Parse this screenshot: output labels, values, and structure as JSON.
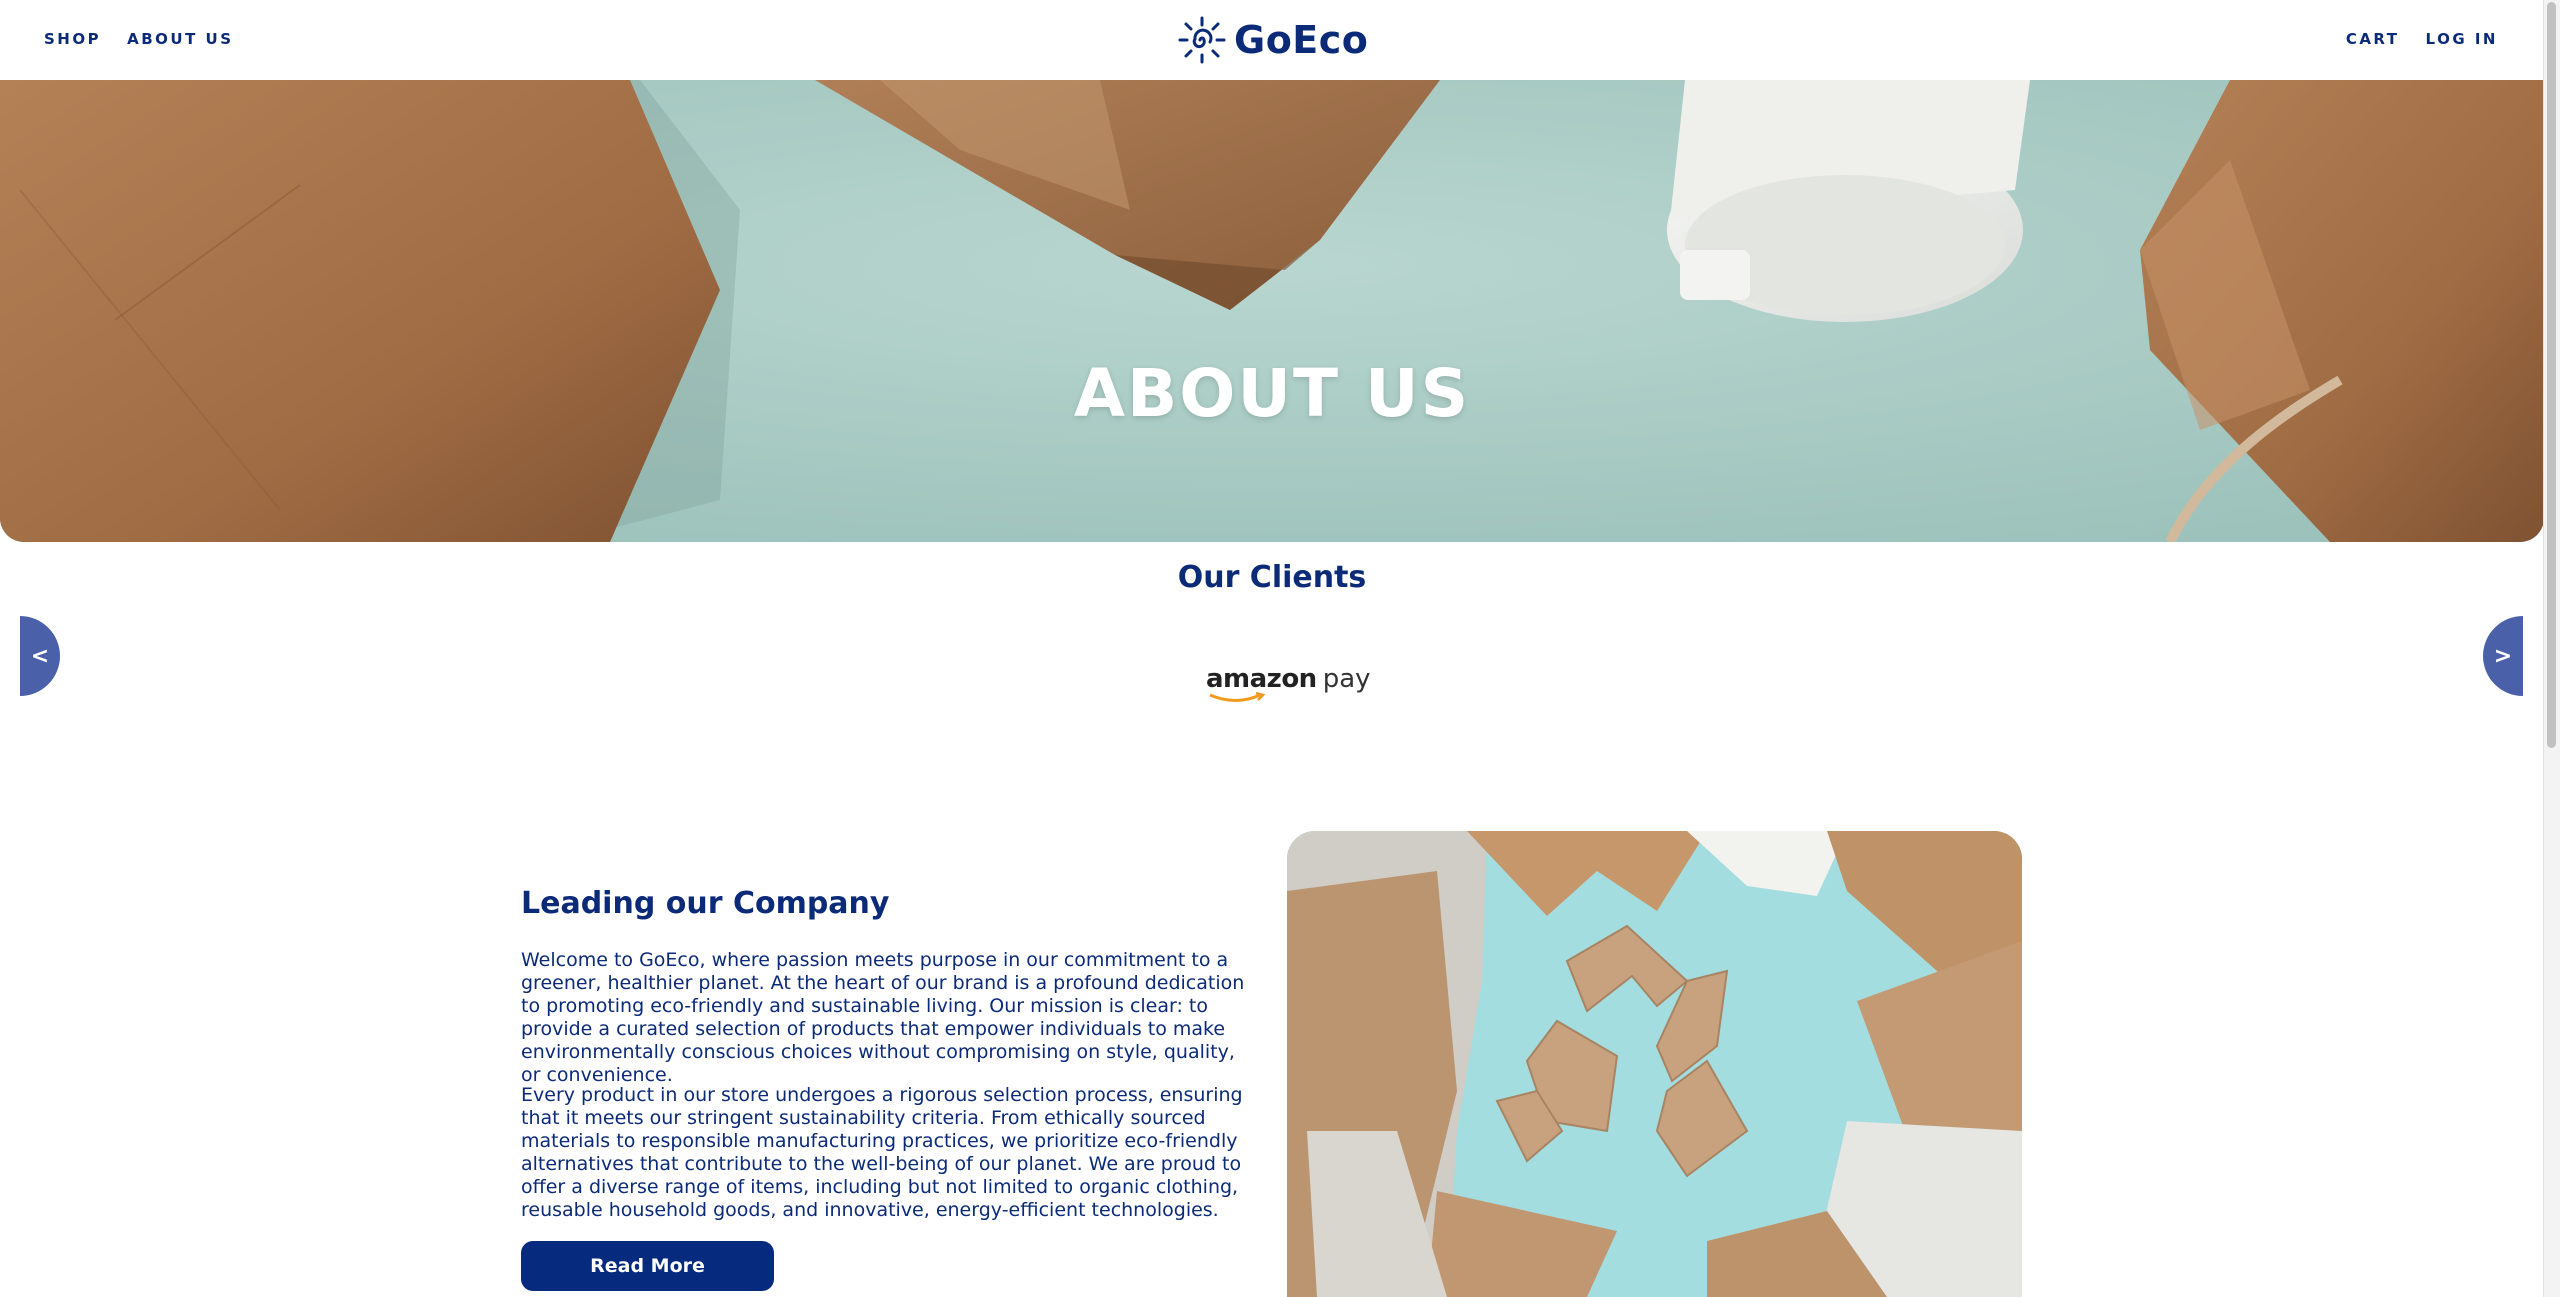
{
  "nav": {
    "shop": "SHOP",
    "about": "ABOUT US",
    "cart": "CART",
    "login": "LOG IN"
  },
  "brand": {
    "name": "GoEco"
  },
  "hero": {
    "title": "ABOUT US"
  },
  "clients": {
    "title": "Our Clients",
    "prev": "<",
    "next": ">",
    "logo": {
      "part1": "amazon",
      "part2": "pay"
    }
  },
  "company": {
    "title": "Leading our Company",
    "paragraph1": "Welcome to GoEco, where passion meets purpose in our commitment to a greener, healthier planet. At the heart of our brand is a profound dedication to promoting eco-friendly and sustainable living. Our mission is clear: to provide a curated selection of products that empower individuals to make environmentally conscious choices without compromising on style, quality, or convenience.",
    "paragraph2": "Every product in our store undergoes a rigorous selection process, ensuring that it meets our stringent sustainability criteria. From ethically sourced materials to responsible manufacturing practices, we prioritize eco-friendly alternatives that contribute to the well-being of our planet. We are proud to offer a diverse range of items, including but not limited to organic clothing, reusable household goods, and innovative, energy-efficient technologies.",
    "button": "Read More"
  },
  "colors": {
    "brand": "#0b2a78",
    "button": "#062a7e",
    "arrow": "#4a60a8",
    "hero_bg": "#a9c9c3"
  }
}
